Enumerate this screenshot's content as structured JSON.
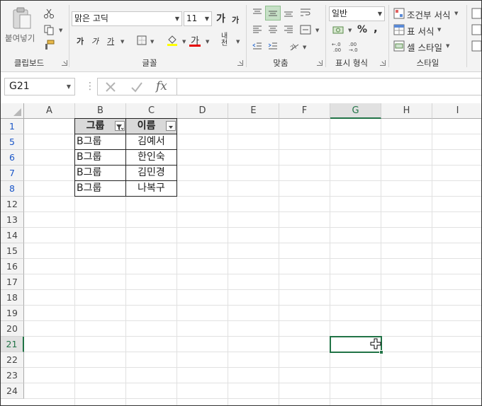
{
  "ribbon": {
    "clipboard": {
      "paste_label": "붙여넣기",
      "group_label": "클립보드"
    },
    "font": {
      "family": "맑은 고딕",
      "size": "11",
      "grow_label": "가",
      "shrink_label": "가",
      "bold_label": "가",
      "italic_label": "가",
      "underline_label": "가",
      "font_color_label": "가",
      "phonetic_label": "내천",
      "group_label": "글꼴",
      "font_color": "#e60000",
      "fill_color": "#ffff00"
    },
    "alignment": {
      "group_label": "맞춤"
    },
    "number": {
      "format": "일반",
      "percent_label": "%",
      "comma_label": ",",
      "group_label": "표시 형식"
    },
    "styles": {
      "conditional_label": "조건부 서식",
      "table_label": "표 서식",
      "cell_styles_label": "셀 스타일",
      "group_label": "스타일"
    }
  },
  "formula_bar": {
    "name_box": "G21",
    "fx_label": "fx",
    "content": ""
  },
  "sheet": {
    "columns": [
      "A",
      "B",
      "C",
      "D",
      "E",
      "F",
      "G",
      "H",
      "I"
    ],
    "selected_column": "G",
    "rows": [
      "1",
      "5",
      "6",
      "7",
      "8",
      "12",
      "13",
      "14",
      "15",
      "16",
      "17",
      "18",
      "19",
      "20",
      "21",
      "22",
      "23",
      "24"
    ],
    "selected_row": "21",
    "filtered_rows": [
      "1",
      "5",
      "6",
      "7",
      "8"
    ],
    "header": [
      "그룹",
      "이름"
    ],
    "data": [
      [
        "B그룹",
        "김예서"
      ],
      [
        "B그룹",
        "한인숙"
      ],
      [
        "B그룹",
        "김민경"
      ],
      [
        "B그룹",
        "나복구"
      ]
    ],
    "accent_color": "#217346",
    "filtered_row_color": "#1a56c8"
  }
}
